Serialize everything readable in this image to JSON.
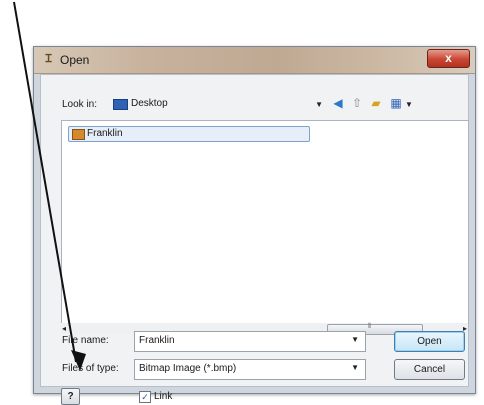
{
  "dialog": {
    "title": "Open",
    "close_label": "x",
    "look_in_label": "Look in:",
    "look_in_value": "Desktop",
    "files": [
      {
        "name": "Franklin",
        "icon": "image-file-icon"
      }
    ],
    "file_name_label": "File name:",
    "file_name_value": "Franklin",
    "file_type_label": "Files of type:",
    "file_type_value": "Bitmap Image (*.bmp)",
    "open_button": "Open",
    "cancel_button": "Cancel",
    "help_button": "?",
    "link_checkbox_label": "Link",
    "link_checked": true
  },
  "icons": {
    "title": "app-icon",
    "back": "back-icon",
    "up": "up-folder-icon",
    "new_folder": "new-folder-icon",
    "views": "views-icon"
  },
  "colors": {
    "close": "#c84633",
    "default_button": "#3c7fb1",
    "selection": "#e6eef9"
  }
}
